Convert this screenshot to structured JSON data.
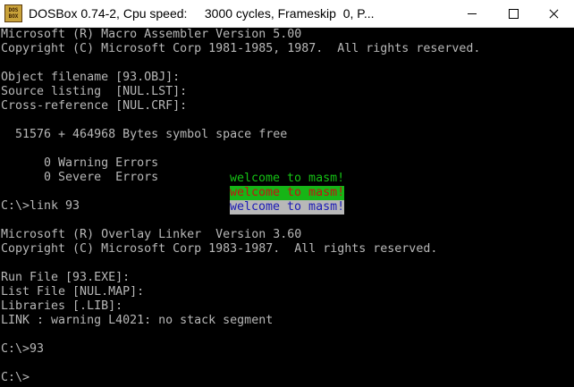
{
  "window": {
    "title": "DOSBox 0.74-2, Cpu speed:     3000 cycles, Frameskip  0, P...",
    "icon_text_top": "DOS",
    "icon_text_bottom": "BOX"
  },
  "console": {
    "lines": [
      "Microsoft (R) Macro Assembler Version 5.00",
      "Copyright (C) Microsoft Corp 1981-1985, 1987.  All rights reserved.",
      "",
      "Object filename [93.OBJ]:",
      "Source listing  [NUL.LST]:",
      "Cross-reference [NUL.CRF]:",
      "",
      "  51576 + 464968 Bytes symbol space free",
      "",
      "      0 Warning Errors",
      "      0 Severe  Errors",
      "",
      "C:\\>link 93",
      "",
      "Microsoft (R) Overlay Linker  Version 3.60",
      "Copyright (C) Microsoft Corp 1983-1987.  All rights reserved.",
      "",
      "Run File [93.EXE]:",
      "List File [NUL.MAP]:",
      "Libraries [.LIB]:",
      "LINK : warning L4021: no stack segment",
      "",
      "C:\\>93",
      "",
      "C:\\>"
    ],
    "program_output": [
      "welcome to masm!",
      "welcome to masm!",
      "welcome to masm!"
    ],
    "program_output_colors": [
      {
        "fg": "#15c215",
        "bg": "#000000"
      },
      {
        "fg": "#c41313",
        "bg": "#16b516"
      },
      {
        "fg": "#1b1bb5",
        "bg": "#b8b8b8"
      }
    ],
    "default_text_color": "#b8b8b8",
    "background_color": "#000000"
  }
}
